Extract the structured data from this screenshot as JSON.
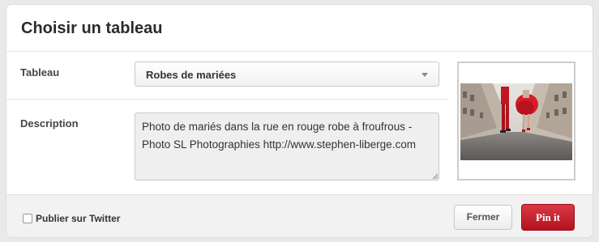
{
  "dialog": {
    "title": "Choisir un tableau"
  },
  "board": {
    "label": "Tableau",
    "selected": "Robes de mariées"
  },
  "description": {
    "label": "Description",
    "value": "Photo de mariés dans la rue en rouge robe à froufrous - Photo SL Photographies http://www.stephen-liberge.com"
  },
  "preview": {
    "image": "wedding-couple-street-photo"
  },
  "footer": {
    "twitter_label": "Publier sur Twitter",
    "twitter_checked": false,
    "close_label": "Fermer",
    "pin_label": "Pin it"
  },
  "colors": {
    "pin_button": "#c8232c",
    "background": "#e9e9e9"
  }
}
